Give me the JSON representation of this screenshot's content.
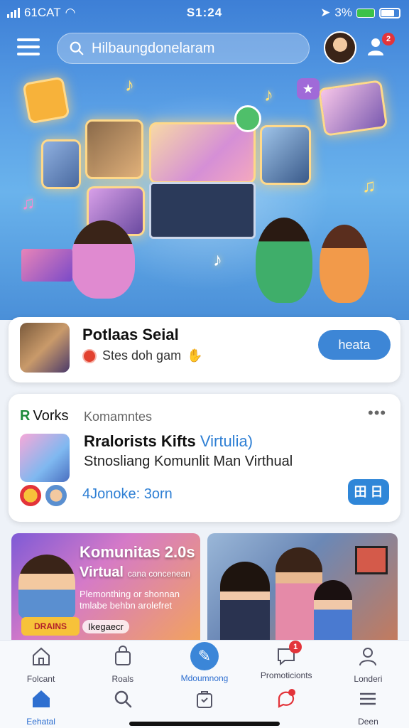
{
  "status_bar": {
    "carrier": "61CAT",
    "time": "S1:24",
    "battery_pct": "3%"
  },
  "header": {
    "search_placeholder": "Hilbaungdonelaram",
    "notification_count": "2"
  },
  "featured_card": {
    "title": "Potlaas Seial",
    "subtitle": "Stes doh gam",
    "button_label": "heata"
  },
  "post_card": {
    "brand_letter": "R",
    "brand": "Vorks",
    "category": "Komamntes",
    "more": "•••",
    "title_main": "Rralorists Kifts",
    "title_accent": "Virtulia)",
    "description": "Stnosliang Komunlit Man Virthual",
    "meta": "4Jonoke: 3orn",
    "share_label": "田 日"
  },
  "promo_left": {
    "title": "Komunitas 2.0s",
    "subtitle": "Virtual",
    "subtitle_small": "cana concenean",
    "body": "Plemonthing or shonnan tmlabe behbn arolefret",
    "logo_text": "DRAINS",
    "tag": "Ikegaecr"
  },
  "bottom_nav": {
    "row1": [
      {
        "label": "Folcant",
        "icon": "home-outline-icon"
      },
      {
        "label": "Roals",
        "icon": "shopping-bag-icon"
      },
      {
        "label": "Mdoumnong",
        "icon": "feather-icon"
      },
      {
        "label": "Promoticionts",
        "icon": "chat-icon",
        "badge": "1"
      },
      {
        "label": "Londeri",
        "icon": "user-icon"
      }
    ],
    "row2": [
      {
        "label": "Eehatal",
        "icon": "home-filled-icon"
      },
      {
        "label": "",
        "icon": "search-icon"
      },
      {
        "label": "",
        "icon": "bag-icon"
      },
      {
        "label": "",
        "icon": "message-icon"
      },
      {
        "label": "Deen",
        "icon": "menu-icon"
      }
    ]
  },
  "colors": {
    "primary": "#3d86d6",
    "hero_top": "#3d7fd6",
    "badge": "#e3343a"
  }
}
